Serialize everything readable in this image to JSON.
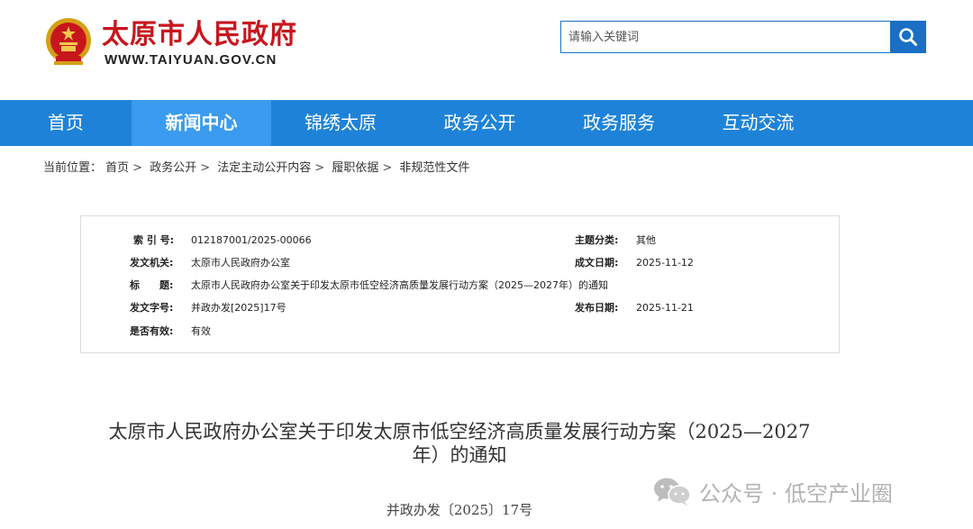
{
  "header": {
    "site_title": "太原市人民政府",
    "site_url": "WWW.TAIYUAN.GOV.CN",
    "search_placeholder": "请输入关键词"
  },
  "nav": {
    "items": [
      {
        "label": "首页"
      },
      {
        "label": "新闻中心",
        "active": true
      },
      {
        "label": "锦绣太原"
      },
      {
        "label": "政务公开"
      },
      {
        "label": "政务服务"
      },
      {
        "label": "互动交流"
      }
    ]
  },
  "breadcrumb": {
    "prefix": "当前位置：",
    "items": [
      "首页",
      "政务公开",
      "法定主动公开内容",
      "履职依据",
      "非规范性文件"
    ],
    "separator": ">"
  },
  "meta": {
    "index_label": "索 引 号:",
    "index_value": "012187001/2025-00066",
    "topic_label": "主题分类:",
    "topic_value": "其他",
    "issuer_label": "发文机关:",
    "issuer_value": "太原市人民政府办公室",
    "created_label": "成文日期:",
    "created_value": "2025-11-12",
    "title_label": "标　　题:",
    "title_value": "太原市人民政府办公室关于印发太原市低空经济高质量发展行动方案（2025—2027年）的通知",
    "docno_label": "发文字号:",
    "docno_value": "并政办发[2025]17号",
    "published_label": "发布日期:",
    "published_value": "2025-11-21",
    "valid_label": "是否有效:",
    "valid_value": "有效"
  },
  "document": {
    "title_line1": "太原市人民政府办公室关于印发太原市低空经济高质量发展行动方案（2025—2027",
    "title_line2": "年）的通知",
    "number": "并政办发〔2025〕17号"
  },
  "watermark": {
    "text": "公众号 · 低空产业圈"
  },
  "colors": {
    "brand_red": "#c8161d",
    "nav_blue": "#1e83d8",
    "nav_active": "#3a9bef",
    "search_blue": "#1a6fc4"
  }
}
